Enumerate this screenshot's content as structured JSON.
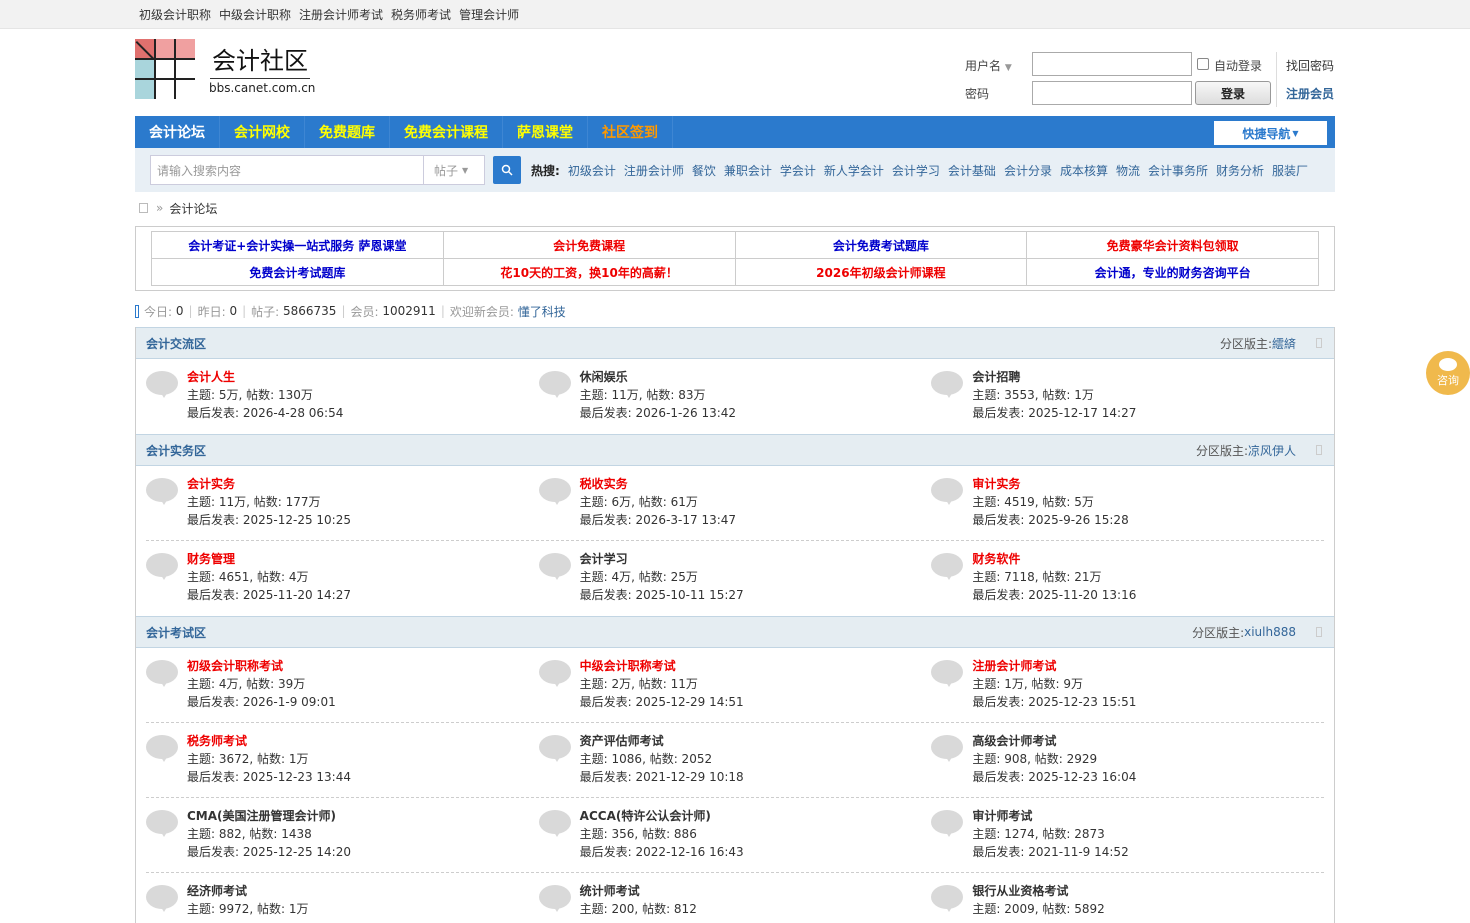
{
  "topbar": {
    "links": [
      "初级会计职称",
      "中级会计职称",
      "注册会计师考试",
      "税务师考试",
      "管理会计师"
    ]
  },
  "header": {
    "title": "会计社区",
    "subtitle": "bbs.canet.com.cn",
    "logo_colors": [
      "#e0706e",
      "#c96060",
      "#f0a0a0",
      "#a9d5dc"
    ]
  },
  "login": {
    "username_label": "用户名",
    "password_label": "密码",
    "auto_login": "自动登录",
    "login_button": "登录",
    "find_password": "找回密码",
    "register": "注册会员"
  },
  "nav": {
    "items": [
      "会计论坛",
      "会计网校",
      "免费题库",
      "免费会计课程",
      "萨恩课堂",
      "社区签到"
    ],
    "quick": "快捷导航"
  },
  "search": {
    "placeholder": "请输入搜索内容",
    "type": "帖子",
    "hot_label": "热搜:",
    "hot": [
      "初级会计",
      "注册会计师",
      "餐饮",
      "兼职会计",
      "学会计",
      "新人学会计",
      "会计学习",
      "会计基础",
      "会计分录",
      "成本核算",
      "物流",
      "会计事务所",
      "财务分析",
      "服装厂"
    ]
  },
  "breadcrumb": {
    "current": "会计论坛"
  },
  "ads": [
    [
      {
        "text": "会计考证+会计实操一站式服务 萨恩课堂",
        "color": "#0000cc"
      },
      {
        "text": "会计免费课程",
        "color": "#e00"
      },
      {
        "text": "会计免费考试题库",
        "color": "#0000cc"
      },
      {
        "text": "免费豪华会计资料包领取",
        "color": "#e00"
      }
    ],
    [
      {
        "text": "免费会计考试题库",
        "color": "#0000cc"
      },
      {
        "text": "花10天的工资，换10年的高薪！",
        "color": "#e00"
      },
      {
        "text": "2026年初级会计师课程",
        "color": "#e00"
      },
      {
        "text": "会计通，专业的财务咨询平台",
        "color": "#0000cc"
      }
    ]
  ],
  "stats": {
    "today_label": "今日:",
    "today": "0",
    "yesterday_label": "昨日:",
    "yesterday": "0",
    "posts_label": "帖子:",
    "posts": "5866735",
    "members_label": "会员:",
    "members": "1002911",
    "welcome_label": "欢迎新会员:",
    "welcome": "懂了科技"
  },
  "sections": [
    {
      "name": "会计交流区",
      "mod_label": "分区版主:",
      "mod": "繧緕",
      "rows": [
        [
          {
            "title": "会计人生",
            "red": true,
            "stats": "主题: 5万, 帖数: 130万",
            "last": "最后发表: 2026-4-28 06:54"
          },
          {
            "title": "休闲娱乐",
            "red": false,
            "stats": "主题: 11万, 帖数: 83万",
            "last": "最后发表: 2026-1-26 13:42"
          },
          {
            "title": "会计招聘",
            "red": false,
            "stats": "主题: 3553, 帖数: 1万",
            "last": "最后发表: 2025-12-17 14:27"
          }
        ]
      ]
    },
    {
      "name": "会计实务区",
      "mod_label": "分区版主:",
      "mod": "凉风伊人",
      "rows": [
        [
          {
            "title": "会计实务",
            "red": true,
            "stats": "主题: 11万, 帖数: 177万",
            "last": "最后发表: 2025-12-25 10:25"
          },
          {
            "title": "税收实务",
            "red": true,
            "stats": "主题: 6万, 帖数: 61万",
            "last": "最后发表: 2026-3-17 13:47"
          },
          {
            "title": "审计实务",
            "red": true,
            "stats": "主题: 4519, 帖数: 5万",
            "last": "最后发表: 2025-9-26 15:28"
          }
        ],
        [
          {
            "title": "财务管理",
            "red": true,
            "stats": "主题: 4651, 帖数: 4万",
            "last": "最后发表: 2025-11-20 14:27"
          },
          {
            "title": "会计学习",
            "red": false,
            "stats": "主题: 4万, 帖数: 25万",
            "last": "最后发表: 2025-10-11 15:27"
          },
          {
            "title": "财务软件",
            "red": true,
            "stats": "主题: 7118, 帖数: 21万",
            "last": "最后发表: 2025-11-20 13:16"
          }
        ]
      ]
    },
    {
      "name": "会计考试区",
      "mod_label": "分区版主:",
      "mod": "xiulh888",
      "rows": [
        [
          {
            "title": "初级会计职称考试",
            "red": true,
            "stats": "主题: 4万, 帖数: 39万",
            "last": "最后发表: 2026-1-9 09:01"
          },
          {
            "title": "中级会计职称考试",
            "red": true,
            "stats": "主题: 2万, 帖数: 11万",
            "last": "最后发表: 2025-12-29 14:51"
          },
          {
            "title": "注册会计师考试",
            "red": true,
            "stats": "主题: 1万, 帖数: 9万",
            "last": "最后发表: 2025-12-23 15:51"
          }
        ],
        [
          {
            "title": "税务师考试",
            "red": true,
            "stats": "主题: 3672, 帖数: 1万",
            "last": "最后发表: 2025-12-23 13:44"
          },
          {
            "title": "资产评估师考试",
            "red": false,
            "stats": "主题: 1086, 帖数: 2052",
            "last": "最后发表: 2021-12-29 10:18"
          },
          {
            "title": "高级会计师考试",
            "red": false,
            "stats": "主题: 908, 帖数: 2929",
            "last": "最后发表: 2025-12-23 16:04"
          }
        ],
        [
          {
            "title": "CMA(美国注册管理会计师)",
            "red": false,
            "stats": "主题: 882, 帖数: 1438",
            "last": "最后发表: 2025-12-25 14:20"
          },
          {
            "title": "ACCA(特许公认会计师)",
            "red": false,
            "stats": "主题: 356, 帖数: 886",
            "last": "最后发表: 2022-12-16 16:43"
          },
          {
            "title": "审计师考试",
            "red": false,
            "stats": "主题: 1274, 帖数: 2873",
            "last": "最后发表: 2021-11-9 14:52"
          }
        ],
        [
          {
            "title": "经济师考试",
            "red": false,
            "stats": "主题: 9972, 帖数: 1万",
            "last": ""
          },
          {
            "title": "统计师考试",
            "red": false,
            "stats": "主题: 200, 帖数: 812",
            "last": ""
          },
          {
            "title": "银行从业资格考试",
            "red": false,
            "stats": "主题: 2009, 帖数: 5892",
            "last": ""
          }
        ]
      ]
    }
  ],
  "float": {
    "label": "咨询"
  }
}
